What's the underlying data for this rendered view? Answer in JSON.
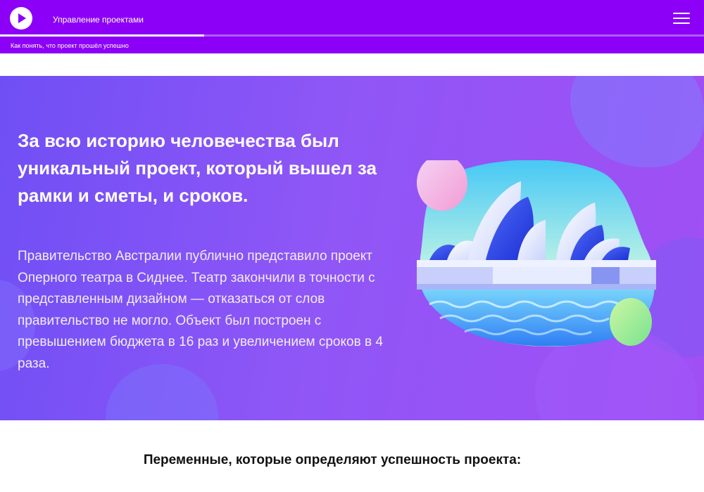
{
  "header": {
    "course_title": "Управление проектами",
    "lesson_title": "Как понять, что проект прошёл успешно",
    "progress_fraction": 0.29,
    "logo_icon": "play-icon",
    "menu_icon": "hamburger-menu-icon"
  },
  "hero": {
    "heading": "За всю историю человечества был уникальный проект, который вышел за рамки и сметы, и сроков.",
    "text": "Правительство Австралии публично представило проект Оперного театра в Сиднее. Театр закончили в точности с представленным дизайном — отказаться от слов правительство не могло. Объект был построен с превышением бюджета в 16 раз и увеличением сроков в 4 раза.",
    "illustration": "sydney-opera-house-illustration"
  },
  "section": {
    "heading": "Переменные, которые определяют успешность проекта:"
  },
  "colors": {
    "brand": "#8c00f7",
    "hero_start": "#6f4ff5",
    "hero_end": "#a14ff4"
  }
}
